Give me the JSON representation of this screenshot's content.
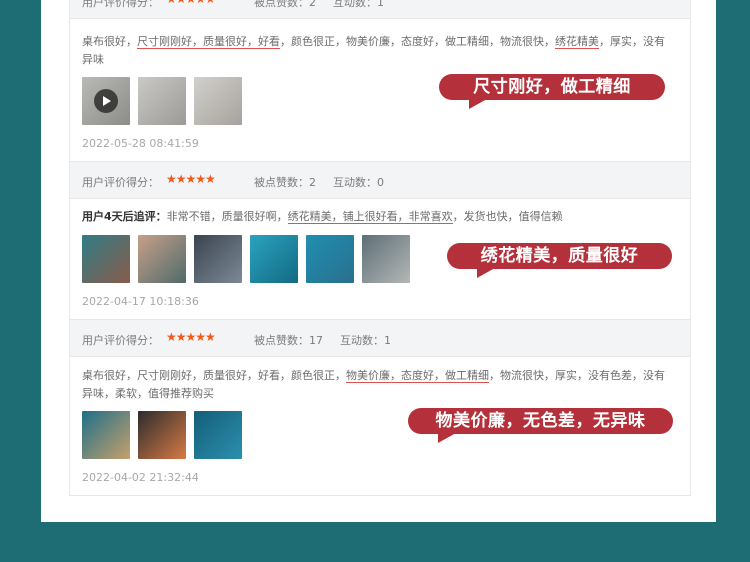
{
  "labels": {
    "rating": "用户评价得分：",
    "likes_prefix": "被点赞数：",
    "interact_prefix": "互动数："
  },
  "reviews": [
    {
      "likes": "2",
      "interactions": "1",
      "text_parts": [
        {
          "t": "桌布很好，",
          "u": false
        },
        {
          "t": "尺寸刚刚好，质量很好，好看",
          "u": true
        },
        {
          "t": "，颜色很正，物美价廉，态度好，做工精细，物流很快，",
          "u": false
        },
        {
          "t": "绣花精美",
          "u": true
        },
        {
          "t": "，厚实，没有异味",
          "u": false
        }
      ],
      "date": "2022-05-28 08:41:59",
      "bubble": "尺寸刚好，做工精细",
      "thumbs": [
        {
          "colors": [
            "#b9b9b6",
            "#8c8c88"
          ],
          "video": true
        },
        {
          "colors": [
            "#c9c9c6",
            "#9c9a96"
          ],
          "video": false
        },
        {
          "colors": [
            "#d2d0cc",
            "#a6a39e"
          ],
          "video": false
        }
      ]
    },
    {
      "likes": "2",
      "interactions": "0",
      "prefix": "用户4天后追评：",
      "text_parts": [
        {
          "t": "非常不错，质量很好啊，",
          "u": false
        },
        {
          "t": "绣花精美，铺上很好看，非常喜欢",
          "u": true
        },
        {
          "t": "，发货也快，值得信赖",
          "u": false
        }
      ],
      "date": "2022-04-17 10:18:36",
      "bubble": "绣花精美，质量很好",
      "thumbs": [
        {
          "colors": [
            "#2f7d86",
            "#8a5a4a"
          ],
          "video": false
        },
        {
          "colors": [
            "#c7a089",
            "#4f6b6b"
          ],
          "video": false
        },
        {
          "colors": [
            "#3a4450",
            "#7c8a96"
          ],
          "video": false
        },
        {
          "colors": [
            "#2aa3c0",
            "#136a82"
          ],
          "video": false
        },
        {
          "colors": [
            "#1f8fb2",
            "#2a6f8c"
          ],
          "video": false
        },
        {
          "colors": [
            "#5d6f78",
            "#b4b7b5"
          ],
          "video": false
        }
      ]
    },
    {
      "likes": "17",
      "interactions": "1",
      "text_parts": [
        {
          "t": "桌布很好，尺寸刚刚好，质量很好，好看，颜色很正，",
          "u": false
        },
        {
          "t": "物美价廉，态度好，做工精细",
          "u": true
        },
        {
          "t": "，物流很快，厚实，没有色差，没有异味，柔软，值得推荐购买",
          "u": false
        }
      ],
      "date": "2022-04-02 21:32:44",
      "bubble": "物美价廉，无色差，无异味",
      "thumbs": [
        {
          "colors": [
            "#1e6f8a",
            "#c7a06b"
          ],
          "video": false
        },
        {
          "colors": [
            "#2c2c2c",
            "#d87a45"
          ],
          "video": false
        },
        {
          "colors": [
            "#145e78",
            "#2b8fae"
          ],
          "video": false
        }
      ]
    }
  ],
  "header0": {
    "likes": "2",
    "interactions": "1"
  }
}
